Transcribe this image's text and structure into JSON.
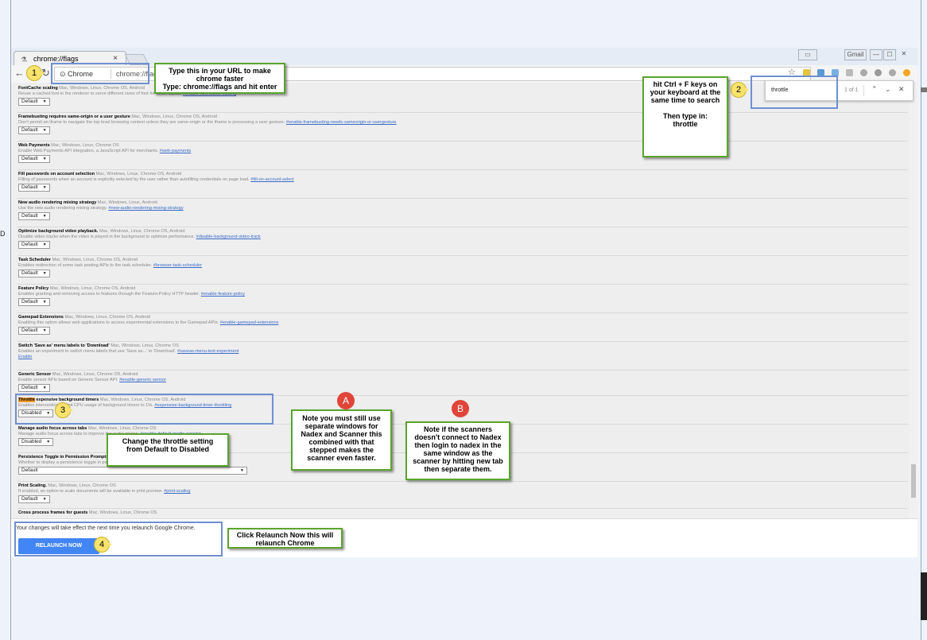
{
  "browser": {
    "tab_title": "chrome://flags",
    "tab_close": "×",
    "chip": "Chrome",
    "url": "chrome://flags",
    "window_controls": [
      "Gmail",
      "—",
      "☐",
      "✕"
    ]
  },
  "left_text": "D",
  "find": {
    "query": "throttle",
    "count": "1 of 1"
  },
  "flags": [
    {
      "title": "FontCache scaling",
      "platforms": "Mac, Windows, Linux, Chrome OS, Android",
      "desc": "Reuse a cached font in the renderer to serve different sizes of font for faster layout.",
      "anchor": "#enable-font-cache-scaling",
      "control": "Default"
    },
    {
      "title": "Framebusting requires same-origin or a user gesture",
      "platforms": "Mac, Windows, Linux, Chrome OS, Android",
      "desc": "Don't permit an iframe to navigate the top level browsing context unless they are same-origin or the iframe is processing a user gesture.",
      "anchor": "#enable-framebusting-needs-sameorigin-or-usergesture",
      "control": "Default"
    },
    {
      "title": "Web Payments",
      "platforms": "Mac, Windows, Linux, Chrome OS",
      "desc": "Enable Web Payments API integration, a JavaScript API for merchants.",
      "anchor": "#web-payments",
      "control": "Default"
    },
    {
      "title": "Fill passwords on account selection",
      "platforms": "Mac, Windows, Linux, Chrome OS, Android",
      "desc": "Filling of passwords when an account is explicitly selected by the user rather than autofilling credentials on page load.",
      "anchor": "#fill-on-account-select",
      "control": "Default"
    },
    {
      "title": "New audio rendering mixing strategy",
      "platforms": "Mac, Windows, Linux, Android",
      "desc": "Use the new audio rendering mixing strategy.",
      "anchor": "#new-audio-rendering-mixing-strategy",
      "control": "Default"
    },
    {
      "title": "Optimize background video playback.",
      "platforms": "Mac, Windows, Linux, Chrome OS, Android",
      "desc": "Disable video tracks when the video is played in the background to optimize performance.",
      "anchor": "#disable-background-video-track",
      "control": "Default"
    },
    {
      "title": "Task Scheduler",
      "platforms": "Mac, Windows, Linux, Chrome OS, Android",
      "desc": "Enables redirection of some task posting APIs to the task scheduler.",
      "anchor": "#browser-task-scheduler",
      "control": "Default"
    },
    {
      "title": "Feature Policy",
      "platforms": "Mac, Windows, Linux, Chrome OS, Android",
      "desc": "Enables granting and removing access to features through the Feature-Policy HTTP header.",
      "anchor": "#enable-feature-policy",
      "control": "Default"
    },
    {
      "title": "Gamepad Extensions",
      "platforms": "Mac, Windows, Linux, Chrome OS, Android",
      "desc": "Enabling this option allows web applications to access experimental extensions to the Gamepad APIs.",
      "anchor": "#enable-gamepad-extensions",
      "control": "Default"
    },
    {
      "title": "Switch 'Save as' menu labels to 'Download'",
      "platforms": "Mac, Windows, Linux, Chrome OS",
      "desc": "Enables an experiment to switch menu labels that use 'Save as...' to 'Download'.",
      "anchor": "#saveas-menu-text-experiment",
      "control": "Enable"
    },
    {
      "title": "Generic Sensor",
      "platforms": "Mac, Windows, Linux, Chrome OS, Android",
      "desc": "Enable sensor APIs based on Generic Sensor API.",
      "anchor": "#enable-generic-sensor",
      "control": "Default"
    },
    {
      "title_hl": "Throttle",
      "title": " expensive background timers",
      "platforms": "Mac, Windows, Linux, Chrome OS, Android",
      "desc": "Enables intervention to limit CPU usage of background timers to 1%.",
      "anchor": "#expensive-background-timer-throttling",
      "control": "Disabled"
    },
    {
      "title": "Manage audio focus across tabs",
      "platforms": "Mac, Windows, Linux, Chrome OS",
      "desc": "Manage audio focus across tabs to improve the audio mixing.",
      "anchor": "#enable-default-media-session",
      "control": "Disabled"
    },
    {
      "title": "Persistence Toggle in Permission Prompts",
      "platforms": "Mac, Windows, Linux, Chrome OS",
      "desc": "Whether to display a persistence toggle in permission prompts.",
      "anchor": "#enable-permission-persistence-toggle",
      "control": "Default"
    },
    {
      "title": "Print Scaling.",
      "platforms": "Mac, Windows, Linux, Chrome OS",
      "desc": "If enabled, an option to scale documents will be available in print preview.",
      "anchor": "#print-scaling",
      "control": "Default"
    },
    {
      "title": "Cross process frames for guests",
      "platforms": "Mac, Windows, Linux, Chrome OS",
      "desc": "",
      "anchor": "",
      "control": ""
    }
  ],
  "relaunch": {
    "message": "Your changes will take effect the next time you relaunch Google Chrome.",
    "button": "RELAUNCH NOW"
  },
  "annotations": {
    "step1": "1",
    "step2": "2",
    "step3": "3",
    "step4": "4",
    "letterA": "A",
    "letterB": "B",
    "note1": "Type this in your URL to make chrome faster\nType: chrome://flags and hit enter",
    "note2": "hit Ctrl + F keys on your keyboard at the same time to search\n\nThen type in:\nthrottle",
    "note3": "Change the throttle setting from Default to  Disabled",
    "note4": "Click Relaunch Now this will relaunch Chrome",
    "noteA": "Note you must still use separate windows for Nadex and Scanner this combined with that stepped makes the scanner even faster.",
    "noteB": "Note if the scanners doesn't connect to Nadex then login to nadex in the same window as the scanner by hitting new tab then separate them."
  },
  "colors": {
    "accent": "#4285f4",
    "note_border": "#5aa52c",
    "highlight_box": "#6f8fd0",
    "find_highlight": "#f39c2c"
  }
}
